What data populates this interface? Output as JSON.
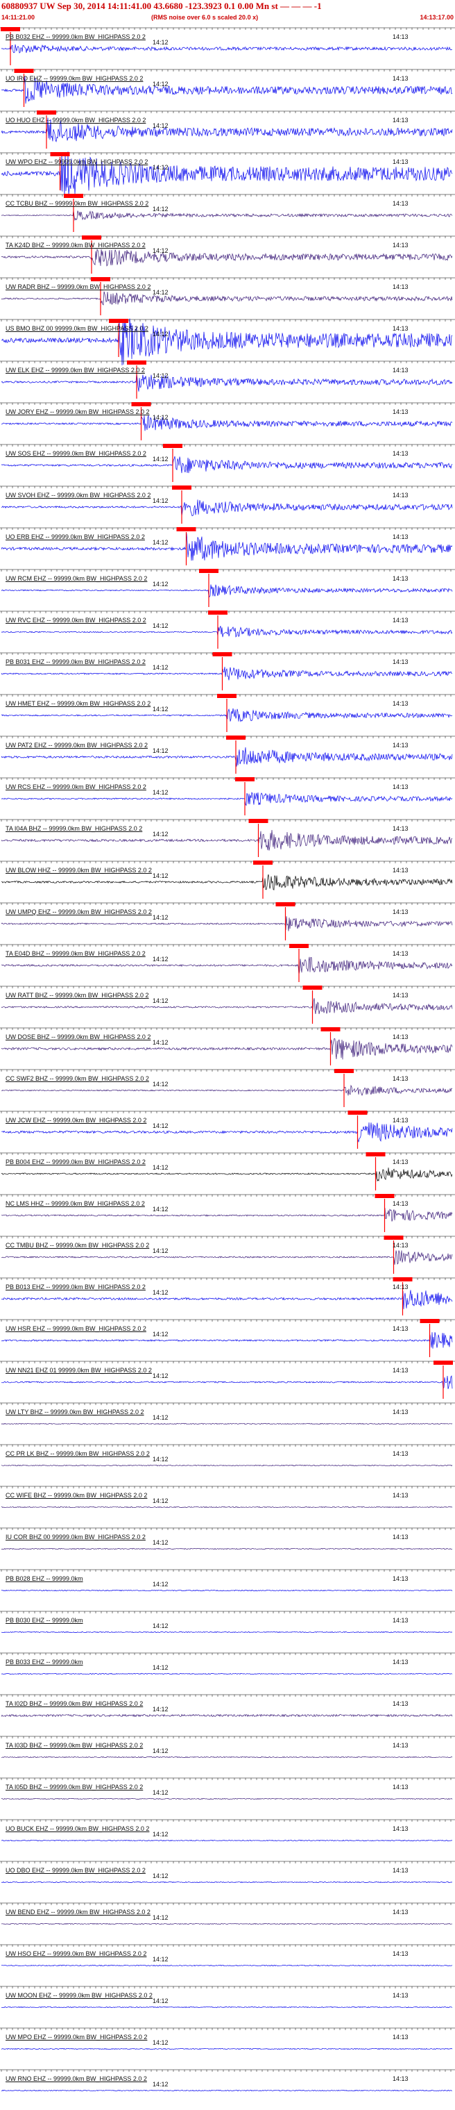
{
  "header": {
    "title": "60880937 UW Sep 30, 2014 14:11:41.00    43.6680 -123.3923  0.1 0.00 Mn st — — — -1",
    "start_time": "14:11:21.00",
    "note": "(RMS noise over 6.0 s scaled 20.0 x)",
    "end_time": "14:13:17.00"
  },
  "time_marks": {
    "a": "14:12",
    "b": "14:13"
  },
  "colors": {
    "blue": "#0000ee",
    "purple": "#3a1a78",
    "black": "#000000",
    "pick": "#ff0000",
    "accent": "#cc0000"
  },
  "traces": [
    {
      "label": "PB B032 EHZ -- 99999.0km BW_HIGHPASS  2.0  2",
      "color": "blue",
      "amp": 0.22,
      "pick": 0.02
    },
    {
      "label": "UO IRO EHZ -- 99999.0km BW_HIGHPASS  2.0  2",
      "color": "blue",
      "amp": 0.55,
      "pick": 0.05
    },
    {
      "label": "UO HUO EHZ -- 99999.0km BW_HIGHPASS  2.0  2",
      "color": "blue",
      "amp": 0.55,
      "pick": 0.1
    },
    {
      "label": "UW WPO EHZ -- 99999.0km BW_HIGHPASS  2.0  2",
      "color": "blue",
      "amp": 1.0,
      "pick": 0.13
    },
    {
      "label": "CC TCBU BHZ -- 99999.0km BW_HIGHPASS  2.0  2",
      "color": "purple",
      "amp": 0.2,
      "pick": 0.16
    },
    {
      "label": "TA K24D BHZ -- 99999.0km BW_HIGHPASS  2.0  2",
      "color": "purple",
      "amp": 0.45,
      "pick": 0.2
    },
    {
      "label": "UW RADR BHZ -- 99999.0km BW_HIGHPASS  2.0  2",
      "color": "purple",
      "amp": 0.3,
      "pick": 0.22
    },
    {
      "label": "US BMO BHZ 00 99999.0km BW_HIGHPASS  2.0  2",
      "color": "blue",
      "amp": 1.0,
      "pick": 0.26
    },
    {
      "label": "UW ELK EHZ -- 99999.0km BW_HIGHPASS  2.0  2",
      "color": "blue",
      "amp": 0.4,
      "pick": 0.3
    },
    {
      "label": "UW JORY EHZ -- 99999.0km BW_HIGHPASS  2.0  2",
      "color": "blue",
      "amp": 0.35,
      "pick": 0.31
    },
    {
      "label": "UW SOS EHZ -- 99999.0km BW_HIGHPASS  2.0  2",
      "color": "blue",
      "amp": 0.4,
      "pick": 0.38
    },
    {
      "label": "UW SVOH EHZ -- 99999.0km BW_HIGHPASS  2.0  2",
      "color": "blue",
      "amp": 0.4,
      "pick": 0.4
    },
    {
      "label": "UO ERB EHZ -- 99999.0km BW_HIGHPASS  2.0  2",
      "color": "blue",
      "amp": 0.6,
      "pick": 0.41
    },
    {
      "label": "UW RCM EHZ -- 99999.0km BW_HIGHPASS  2.0  2",
      "color": "blue",
      "amp": 0.25,
      "pick": 0.46
    },
    {
      "label": "UW RVC EHZ -- 99999.0km BW_HIGHPASS  2.0  2",
      "color": "blue",
      "amp": 0.25,
      "pick": 0.48
    },
    {
      "label": "PB B031 EHZ -- 99999.0km BW_HIGHPASS  2.0  2",
      "color": "blue",
      "amp": 0.3,
      "pick": 0.49
    },
    {
      "label": "UW HMET EHZ -- 99999.0km BW_HIGHPASS  2.0  2",
      "color": "blue",
      "amp": 0.3,
      "pick": 0.5
    },
    {
      "label": "UW PAT2 EHZ -- 99999.0km BW_HIGHPASS  2.0  2",
      "color": "blue",
      "amp": 0.45,
      "pick": 0.52
    },
    {
      "label": "UW RCS EHZ -- 99999.0km BW_HIGHPASS  2.0  2",
      "color": "blue",
      "amp": 0.3,
      "pick": 0.54
    },
    {
      "label": "TA I04A BHZ -- 99999.0km BW_HIGHPASS  2.0  2",
      "color": "purple",
      "amp": 0.5,
      "pick": 0.57
    },
    {
      "label": "UW BLOW HHZ -- 99999.0km BW_HIGHPASS  2.0  2",
      "color": "black",
      "amp": 0.4,
      "pick": 0.58
    },
    {
      "label": "UW UMPQ EHZ -- 99999.0km BW_HIGHPASS  2.0  2",
      "color": "purple",
      "amp": 0.3,
      "pick": 0.63
    },
    {
      "label": "TA E04D BHZ -- 99999.0km BW_HIGHPASS  2.0  2",
      "color": "purple",
      "amp": 0.4,
      "pick": 0.66
    },
    {
      "label": "UW RATT BHZ -- 99999.0km BW_HIGHPASS  2.0  2",
      "color": "purple",
      "amp": 0.35,
      "pick": 0.69
    },
    {
      "label": "UW DOSE BHZ -- 99999.0km BW_HIGHPASS  2.0  2",
      "color": "purple",
      "amp": 0.5,
      "pick": 0.73
    },
    {
      "label": "CC SWF2 BHZ -- 99999.0km BW_HIGHPASS  2.0  2",
      "color": "purple",
      "amp": 0.25,
      "pick": 0.76
    },
    {
      "label": "UW JCW EHZ -- 99999.0km BW_HIGHPASS  2.0  2",
      "color": "blue",
      "amp": 0.5,
      "pick": 0.79
    },
    {
      "label": "PB B004 EHZ -- 99999.0km BW_HIGHPASS  2.0  2",
      "color": "black",
      "amp": 0.3,
      "pick": 0.83
    },
    {
      "label": "NC LMS HHZ -- 99999.0km BW_HIGHPASS  2.0  2",
      "color": "purple",
      "amp": 0.3,
      "pick": 0.85
    },
    {
      "label": "CC TMBU BHZ -- 99999.0km BW_HIGHPASS  2.0  2",
      "color": "purple",
      "amp": 0.3,
      "pick": 0.87
    },
    {
      "label": "PB B013 EHZ -- 99999.0km BW_HIGHPASS  2.0  2",
      "color": "blue",
      "amp": 0.45,
      "pick": 0.89
    },
    {
      "label": "UW HSR EHZ -- 99999.0km BW_HIGHPASS  2.0  2",
      "color": "blue",
      "amp": 0.35,
      "pick": 0.95
    },
    {
      "label": "UW NN21 EHZ 01 99999.0km BW_HIGHPASS  2.0  2",
      "color": "blue",
      "amp": 0.3,
      "pick": 0.98
    },
    {
      "label": "UW LTY BHZ -- 99999.0km BW_HIGHPASS  2.0  2",
      "color": "purple",
      "amp": 0.2,
      "pick": null
    },
    {
      "label": "CC PR LK BHZ -- 99999.0km BW_HIGHPASS  2.0  2",
      "color": "purple",
      "amp": 0.2,
      "pick": null
    },
    {
      "label": "CC WIFE BHZ -- 99999.0km BW_HIGHPASS  2.0  2",
      "color": "purple",
      "amp": 0.2,
      "pick": null
    },
    {
      "label": "IU COR BHZ 00 99999.0km BW_HIGHPASS  2.0  2",
      "color": "purple",
      "amp": 0.2,
      "pick": null
    },
    {
      "label": "PB B028 EHZ -- 99999.0km",
      "color": "blue",
      "amp": 0.2,
      "pick": null
    },
    {
      "label": "PB B030 EHZ -- 99999.0km",
      "color": "blue",
      "amp": 0.2,
      "pick": null
    },
    {
      "label": "PB B033 EHZ -- 99999.0km",
      "color": "blue",
      "amp": 0.2,
      "pick": null
    },
    {
      "label": "TA I02D BHZ -- 99999.0km BW_HIGHPASS  2.0  2",
      "color": "purple",
      "amp": 0.45,
      "pick": null
    },
    {
      "label": "TA I03D BHZ -- 99999.0km BW_HIGHPASS  2.0  2",
      "color": "purple",
      "amp": 0.2,
      "pick": null
    },
    {
      "label": "TA I05D BHZ -- 99999.0km BW_HIGHPASS  2.0  2",
      "color": "purple",
      "amp": 0.2,
      "pick": null
    },
    {
      "label": "UO BUCK EHZ -- 99999.0km BW_HIGHPASS  2.0  2",
      "color": "blue",
      "amp": 0.2,
      "pick": null
    },
    {
      "label": "UO DBO EHZ -- 99999.0km BW_HIGHPASS  2.0  2",
      "color": "blue",
      "amp": 0.2,
      "pick": null
    },
    {
      "label": "UW BEND EHZ -- 99999.0km BW_HIGHPASS  2.0  2",
      "color": "purple",
      "amp": 0.2,
      "pick": null
    },
    {
      "label": "UW HSO EHZ -- 99999.0km BW_HIGHPASS  2.0  2",
      "color": "blue",
      "amp": 0.2,
      "pick": null
    },
    {
      "label": "UW MOON EHZ -- 99999.0km BW_HIGHPASS  2.0  2",
      "color": "blue",
      "amp": 0.2,
      "pick": null
    },
    {
      "label": "UW MPO EHZ -- 99999.0km BW_HIGHPASS  2.0  2",
      "color": "blue",
      "amp": 0.2,
      "pick": null
    },
    {
      "label": "UW RNO EHZ -- 99999.0km BW_HIGHPASS  2.0  2",
      "color": "blue",
      "amp": 0.2,
      "pick": null
    }
  ]
}
